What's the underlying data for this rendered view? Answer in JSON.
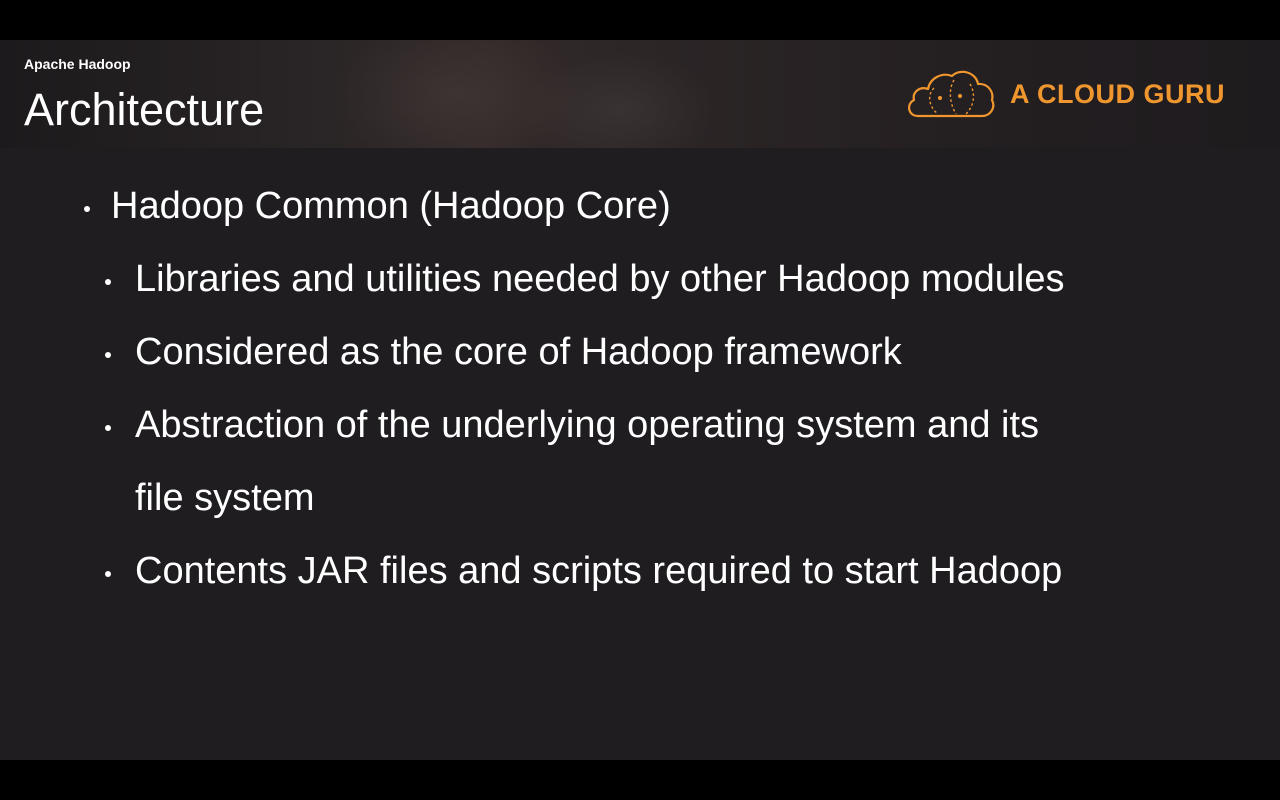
{
  "header": {
    "kicker": "Apache Hadoop",
    "title": "Architecture",
    "brand": {
      "name": "A CLOUD GURU",
      "logo_icon": "cloud-logo-icon",
      "color": "#f0962e"
    }
  },
  "bullets": [
    {
      "level": 1,
      "text": "Hadoop Common (Hadoop Core)"
    },
    {
      "level": 2,
      "text": "Libraries and utilities needed by other Hadoop modules"
    },
    {
      "level": 2,
      "text": "Considered as the core of Hadoop framework"
    },
    {
      "level": 2,
      "text": "Abstraction of the underlying operating system and its",
      "continuation": "file system"
    },
    {
      "level": 2,
      "text": "Contents JAR files and scripts required to start Hadoop"
    }
  ],
  "colors": {
    "background": "#1f1d20",
    "text": "#ffffff",
    "accent": "#f0962e"
  }
}
